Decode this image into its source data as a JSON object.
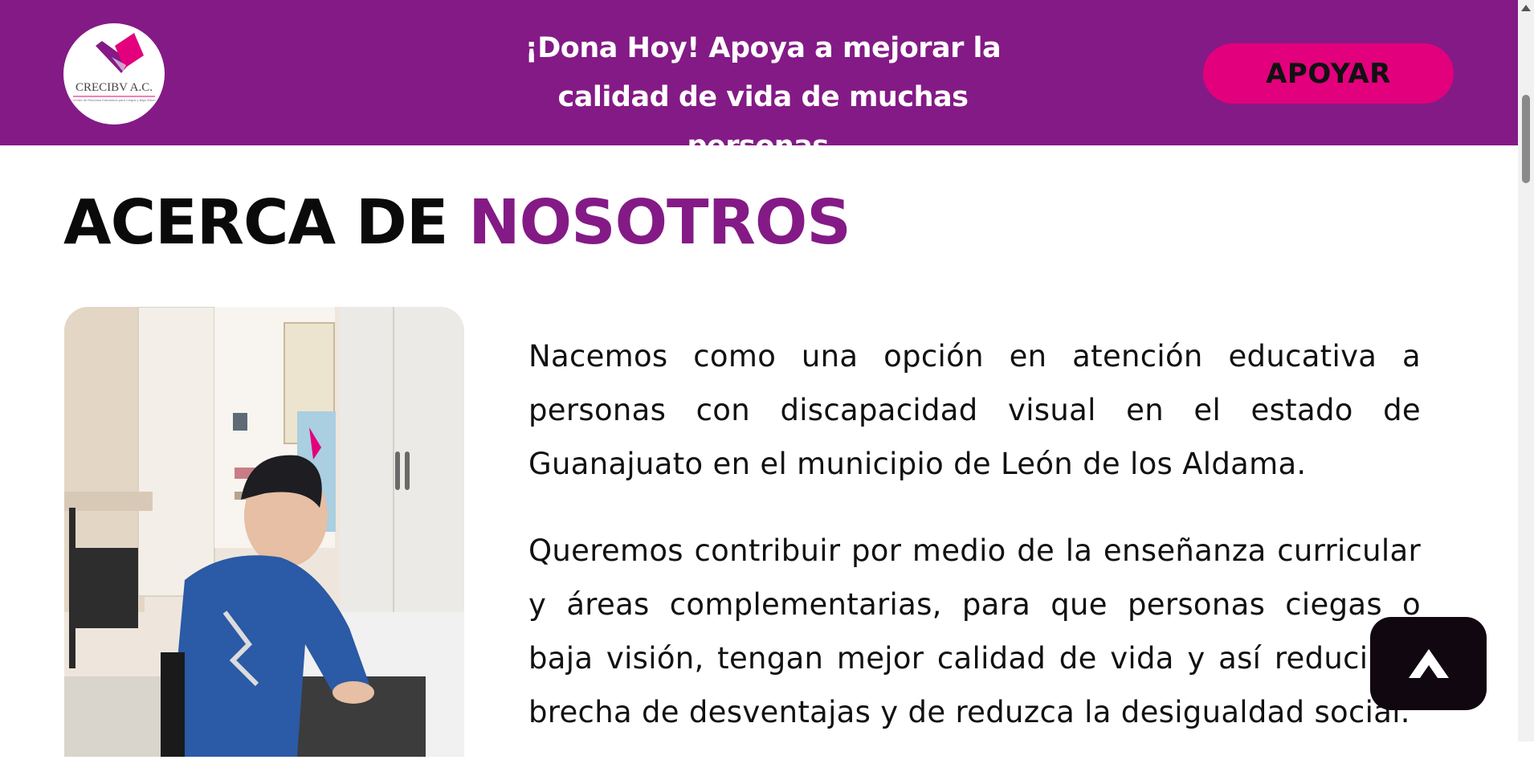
{
  "banner": {
    "logo_text": "CRECIBV A.C.",
    "logo_subtitle": "Centro de Recursos Educativos para Ciegos y Baja Visión",
    "message": "¡Dona Hoy! Apoya a mejorar la calidad de vida de muchas personas.",
    "button_label": "APOYAR"
  },
  "section": {
    "title_part1": "ACERCA DE ",
    "title_part2": "NOSOTROS",
    "paragraphs": [
      "Nacemos como una opción en atención educativa a personas con discapacidad visual en el estado de Guanajuato en el municipio de León de los Aldama.",
      "Queremos contribuir por medio de la enseñanza curricular y áreas complementarias, para que personas ciegas o baja visión, tengan mejor calidad de vida y así reducir la brecha de desventajas y de reduzca la desigualdad social."
    ]
  },
  "scroll_top_icon": "chevron-up-icon",
  "colors": {
    "brand_purple": "#841a86",
    "accent_pink": "#e3007d",
    "dark_button": "#110711"
  }
}
